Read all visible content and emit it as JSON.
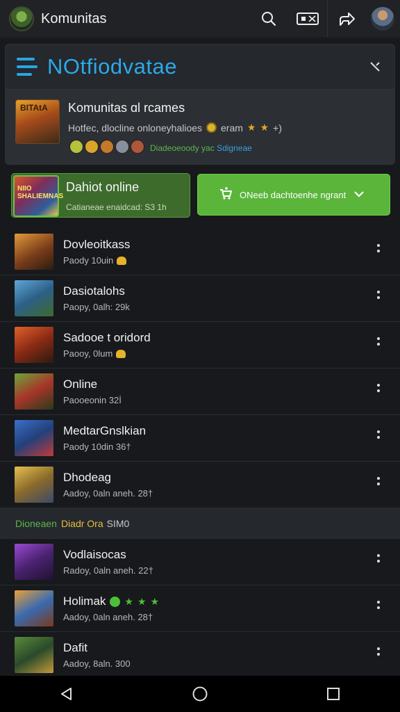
{
  "appbar": {
    "title": "Komunitas",
    "icons": [
      "search-icon",
      "gamepad-icon",
      "share-icon"
    ]
  },
  "community": {
    "brand": "NOtfiodvatae",
    "title": "Komunitas ɑl rcames",
    "subtitle": "Hotfec, dlocline onloneyhalioes",
    "subtitle_tail": "eram",
    "subtitle_end": "+)",
    "thumb_text": "BITAtA",
    "green_text": "Diadeoeoody yac",
    "blue_text": "Sdigneae"
  },
  "featured": {
    "title": "Dahiot online",
    "subtitle": "Catianeae enaidcad: S3 1h",
    "thumb_text": "NIIO SHALIEMNAS"
  },
  "action_button": {
    "label": "ONeeb dachtoenhe ngrant",
    "icon": "cart-icon"
  },
  "games": [
    {
      "name": "Dovleoitkass",
      "meta": "Paody 10uin",
      "badge": "emoji"
    },
    {
      "name": "Dasiotalohs",
      "meta": "Paopy, 0alh: 29k",
      "badge": ""
    },
    {
      "name": "Sadooe t oridord",
      "meta": "Paooy, 0lum",
      "badge": "emoji"
    },
    {
      "name": "Online",
      "meta": "Paooeonin 32İ",
      "badge": ""
    },
    {
      "name": "MedtarGnslkian",
      "meta": "Paody 10din 36†",
      "badge": ""
    },
    {
      "name": "Dhodeag",
      "meta": "Aadoy, 0aln aneh. 28†",
      "badge": ""
    }
  ],
  "section": {
    "green": "Dioneaen",
    "yellow": "Diadr Ora",
    "grey": "SIM0"
  },
  "games2": [
    {
      "name": "Vodlaisocas",
      "meta": "Radoy, 0aln aneh. 22†",
      "stars": false
    },
    {
      "name": "Holimak",
      "meta": "Aadoy, 0aln aneh. 28†",
      "stars": true
    },
    {
      "name": "Dafit",
      "meta": "Aadoy, 8aln. 300",
      "stars": false
    }
  ],
  "colors": {
    "accent_blue": "#2ba9e9",
    "accent_green": "#5ab53a",
    "background": "#17191c"
  }
}
